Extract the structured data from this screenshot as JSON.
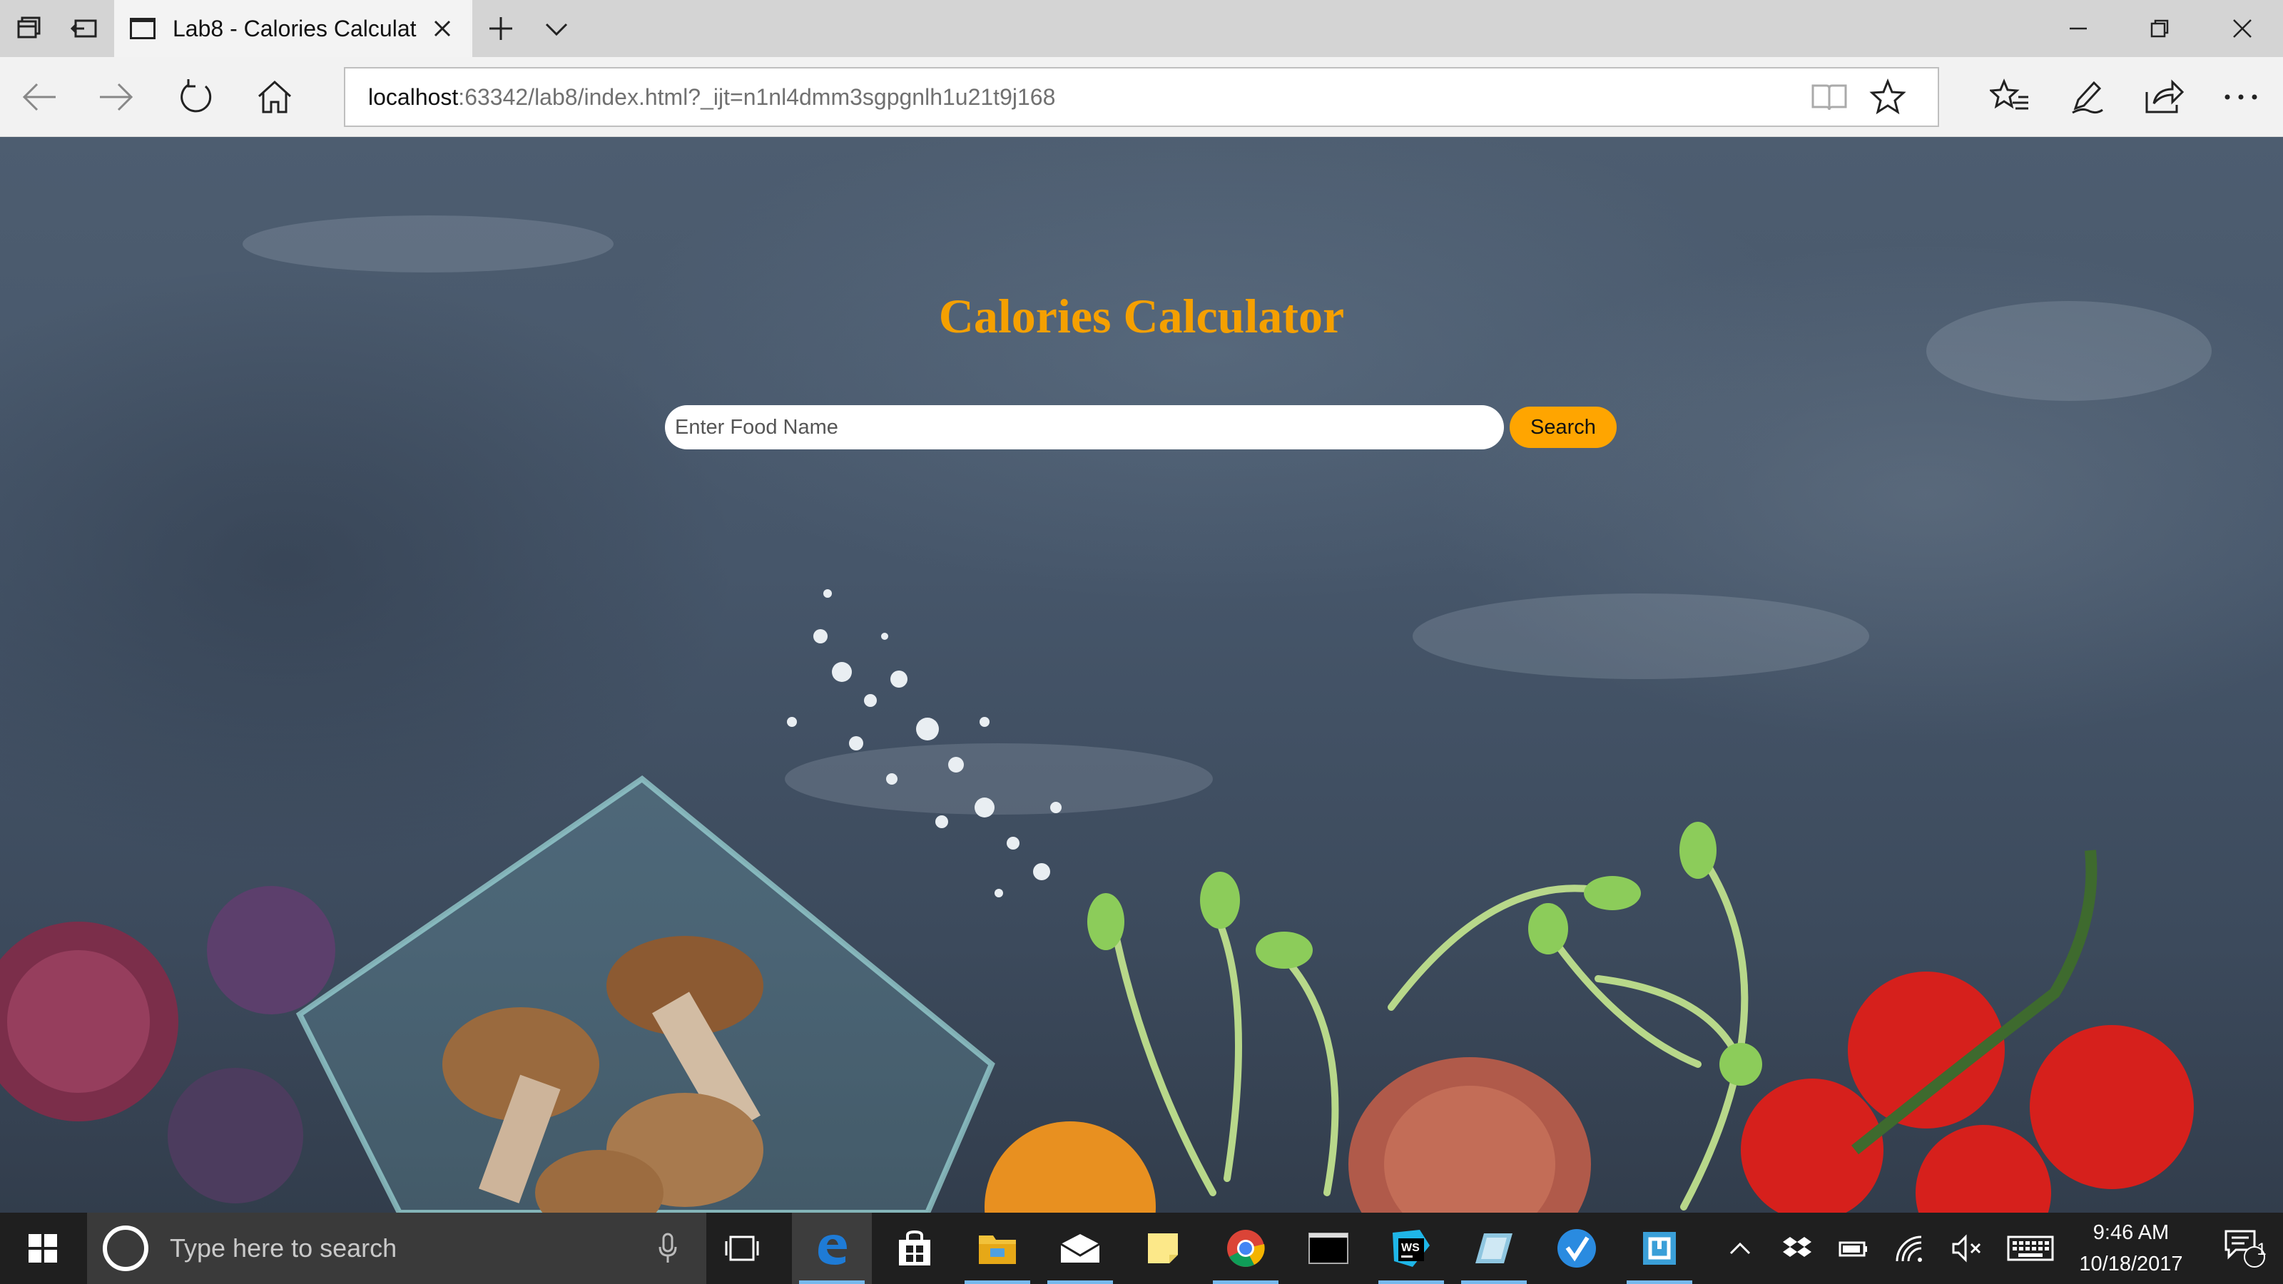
{
  "browser": {
    "tab_title": "Lab8 - Calories Calculat",
    "url_host": "localhost",
    "url_rest": ":63342/lab8/index.html?_ijt=n1nl4dmm3sgpgnlh1u21t9j168",
    "accent": "#0078d7"
  },
  "page": {
    "title": "Calories Calculator",
    "title_color": "#f5a000",
    "search_placeholder": "Enter Food Name",
    "search_button": "Search",
    "button_color": "#ffa500"
  },
  "taskbar": {
    "search_placeholder": "Type here to search",
    "time": "9:46 AM",
    "date": "10/18/2017",
    "notification_count": "1",
    "pinned_apps": [
      "edge-icon",
      "store-icon",
      "file-explorer-icon",
      "mail-icon",
      "sticky-notes-icon",
      "chrome-icon",
      "terminal-icon",
      "webstorm-icon",
      "app-icon",
      "app-icon",
      "app-icon"
    ]
  }
}
